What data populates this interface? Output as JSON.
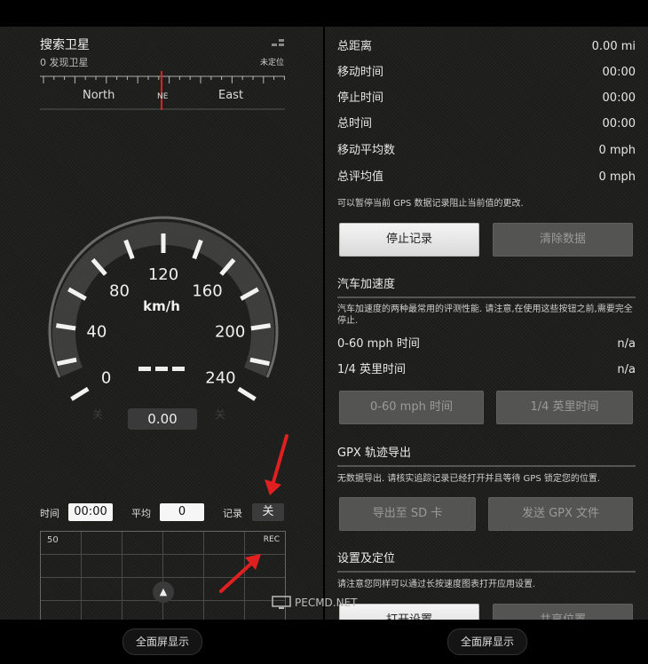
{
  "left": {
    "header": {
      "title": "搜索卫星",
      "subtitle": "0 发现卫星",
      "status": "未定位"
    },
    "compass": {
      "north": "North",
      "ne": "NE",
      "east": "East"
    },
    "gauge": {
      "unit": "km/h",
      "ticks": [
        "0",
        "40",
        "80",
        "120",
        "160",
        "200",
        "240"
      ],
      "digital": "---",
      "speed_value": "0.00",
      "off_left": "关",
      "off_right": "关"
    },
    "controls": {
      "time_label": "时间",
      "time_value": "00:00",
      "avg_label": "平均",
      "avg_value": "0",
      "record_label": "记录",
      "record_value": "关"
    },
    "graph": {
      "max_label": "50",
      "rec_label": "REC"
    },
    "footer": "全面屏显示"
  },
  "right": {
    "stats": [
      {
        "label": "总距离",
        "value": "0.00 mi"
      },
      {
        "label": "移动时间",
        "value": "00:00"
      },
      {
        "label": "停止时间",
        "value": "00:00"
      },
      {
        "label": "总时间",
        "value": "00:00"
      },
      {
        "label": "移动平均数",
        "value": "0 mph"
      },
      {
        "label": "总评均值",
        "value": "0 mph"
      }
    ],
    "pause_note": "可以暂停当前 GPS 数据记录阻止当前值的更改.",
    "stop_button": "停止记录",
    "clear_button": "清除数据",
    "accel_title": "汽车加速度",
    "accel_note": "汽车加速度的两种最常用的评测性能. 请注意,在使用这些按钮之前,需要完全停止.",
    "accel_stats": [
      {
        "label": "0-60 mph 时间",
        "value": "n/a"
      },
      {
        "label": "1/4 英里时间",
        "value": "n/a"
      }
    ],
    "btn_060": "0-60 mph 时间",
    "btn_quarter": "1/4 英里时间",
    "gpx_title": "GPX 轨迹导出",
    "gpx_note": "无数据导出. 请核实追踪记录已经打开并且等待 GPS 锁定您的位置.",
    "export_sd": "导出至 SD 卡",
    "send_gpx": "发送 GPX 文件",
    "settings_title": "设置及定位",
    "settings_note": "请注意您同样可以通过长按速度图表打开应用设置.",
    "open_settings": "打开设置",
    "share_location": "共享位置",
    "footer": "全面屏显示",
    "watermark": "PECMD.NET"
  },
  "colors": {
    "accent_red": "#e02020",
    "panel_bg": "#1c1c1a"
  }
}
